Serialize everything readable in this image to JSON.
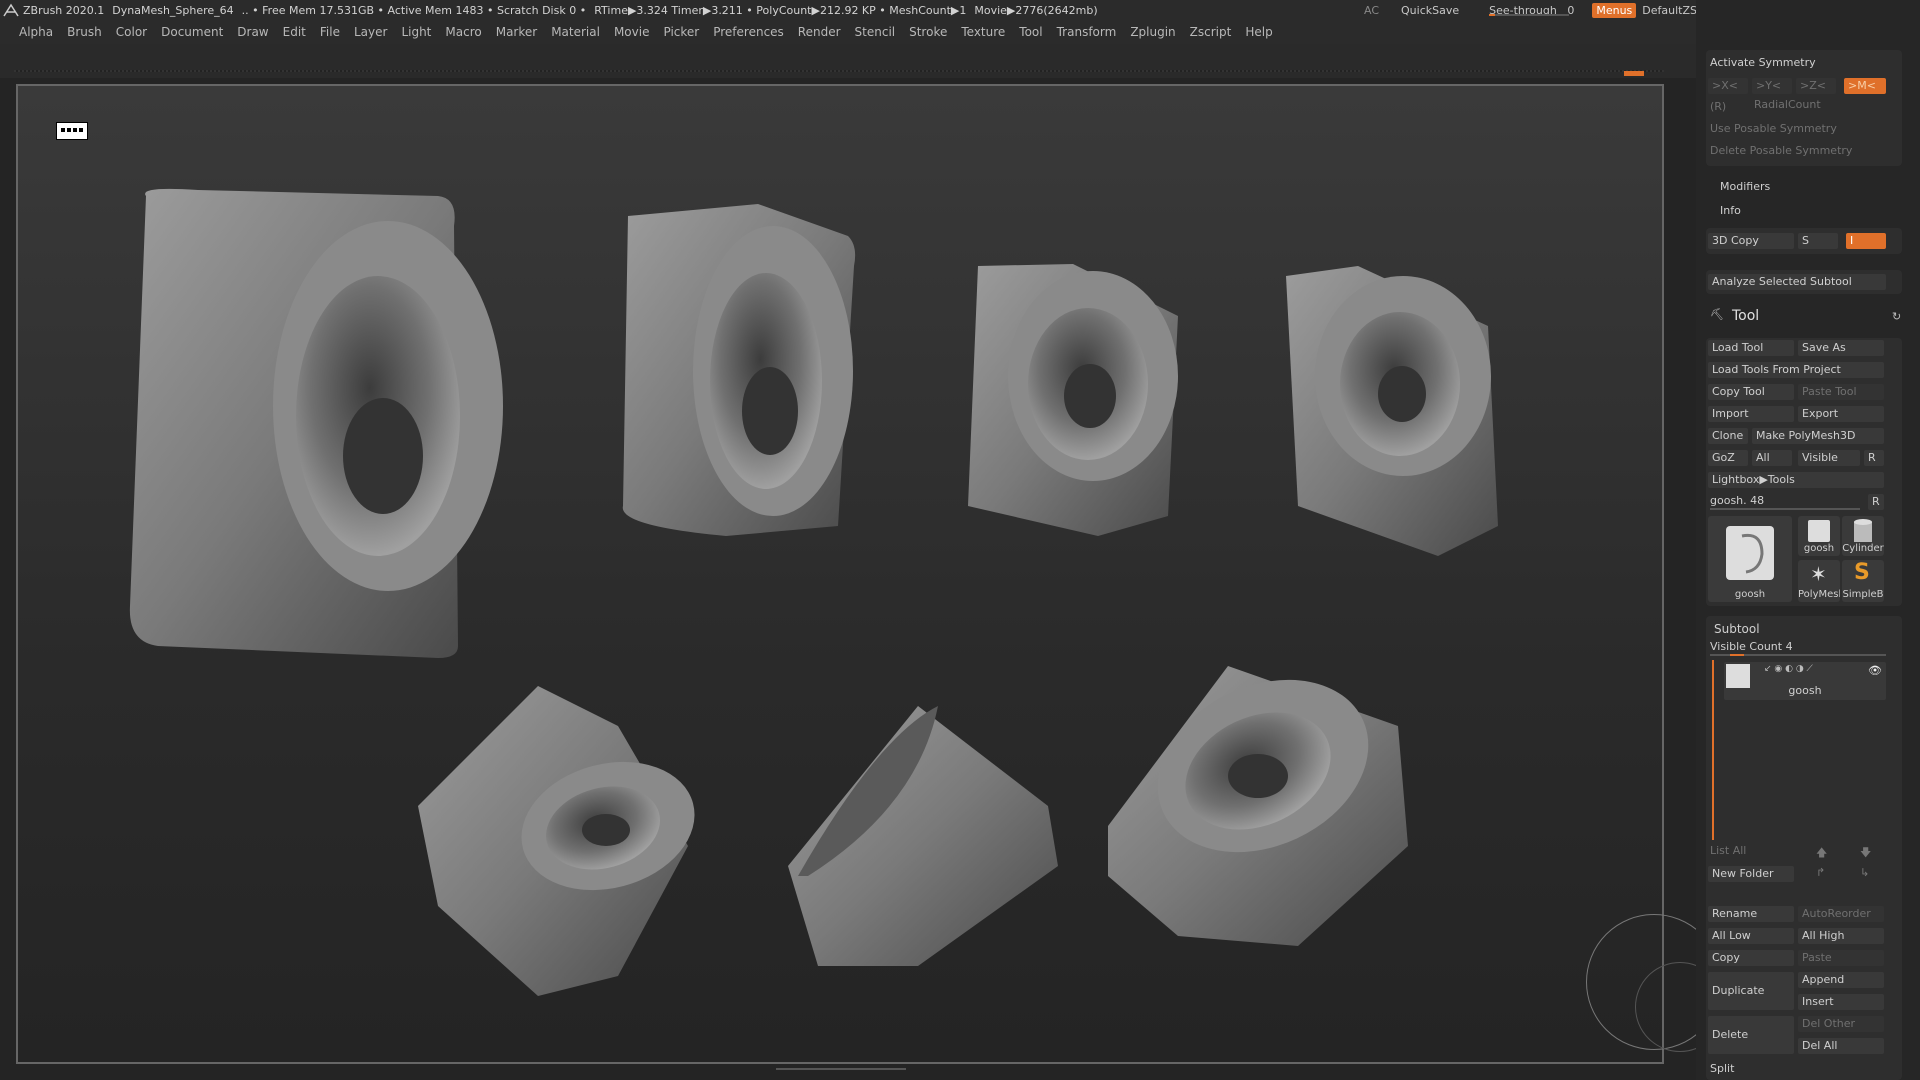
{
  "titlebar": {
    "app": "ZBrush 2020.1",
    "doc": "DynaMesh_Sphere_64",
    "mem": ".. • Free Mem 17.531GB • Active Mem 1483 • Scratch Disk 0 •",
    "timing": "RTime▶3.324 Timer▶3.211 • PolyCount▶212.92 KP • MeshCount▶1",
    "movie": "Movie▶2776(2642mb)",
    "ac": "AC",
    "quicksave": "QuickSave",
    "seethrough": "See-through",
    "seethrough_value": "0",
    "seethrough_level": 0.0,
    "menus": "Menus",
    "script": "DefaultZScript"
  },
  "menubar": [
    "Alpha",
    "Brush",
    "Color",
    "Document",
    "Draw",
    "Edit",
    "File",
    "Layer",
    "Light",
    "Macro",
    "Marker",
    "Material",
    "Movie",
    "Picker",
    "Preferences",
    "Render",
    "Stencil",
    "Stroke",
    "Texture",
    "Tool",
    "Transform",
    "Zplugin",
    "Zscript",
    "Help"
  ],
  "symmetry": {
    "activate": "Activate Symmetry",
    "axes": [
      ">X<",
      ">Y<",
      ">Z<",
      ">M<"
    ],
    "r": "(R)",
    "radial": "RadialCount",
    "use_posable": "Use Posable Symmetry",
    "delete_posable": "Delete Posable Symmetry"
  },
  "modifiers": "Modifiers",
  "info": "Info",
  "copy3d": {
    "label": "3D Copy",
    "s": "S",
    "i": "I"
  },
  "analyze": "Analyze Selected Subtool",
  "tool": {
    "title": "Tool",
    "load_tool": "Load Tool",
    "save_as": "Save As",
    "load_from_project": "Load Tools From Project",
    "copy_tool": "Copy Tool",
    "paste_tool": "Paste Tool",
    "import": "Import",
    "export": "Export",
    "clone": "Clone",
    "make_polymesh": "Make PolyMesh3D",
    "goz": "GoZ",
    "all": "All",
    "visible": "Visible",
    "r": "R",
    "lightbox": "Lightbox▶Tools",
    "current": "goosh. 48",
    "r2": "R",
    "thumbs": [
      "goosh",
      "goosh",
      "Cylinder",
      "PolyMesh",
      "SimpleB"
    ]
  },
  "subtool": {
    "title": "Subtool",
    "visible_count": "Visible Count 4",
    "item": "goosh",
    "list_all": "List All",
    "new_folder": "New Folder",
    "rename": "Rename",
    "autoreorder": "AutoReorder",
    "all_low": "All Low",
    "all_high": "All High",
    "copy": "Copy",
    "paste": "Paste",
    "duplicate": "Duplicate",
    "append": "Append",
    "insert": "Insert",
    "delete": "Delete",
    "del_other": "Del Other",
    "del_all": "Del All",
    "split": "Split"
  }
}
